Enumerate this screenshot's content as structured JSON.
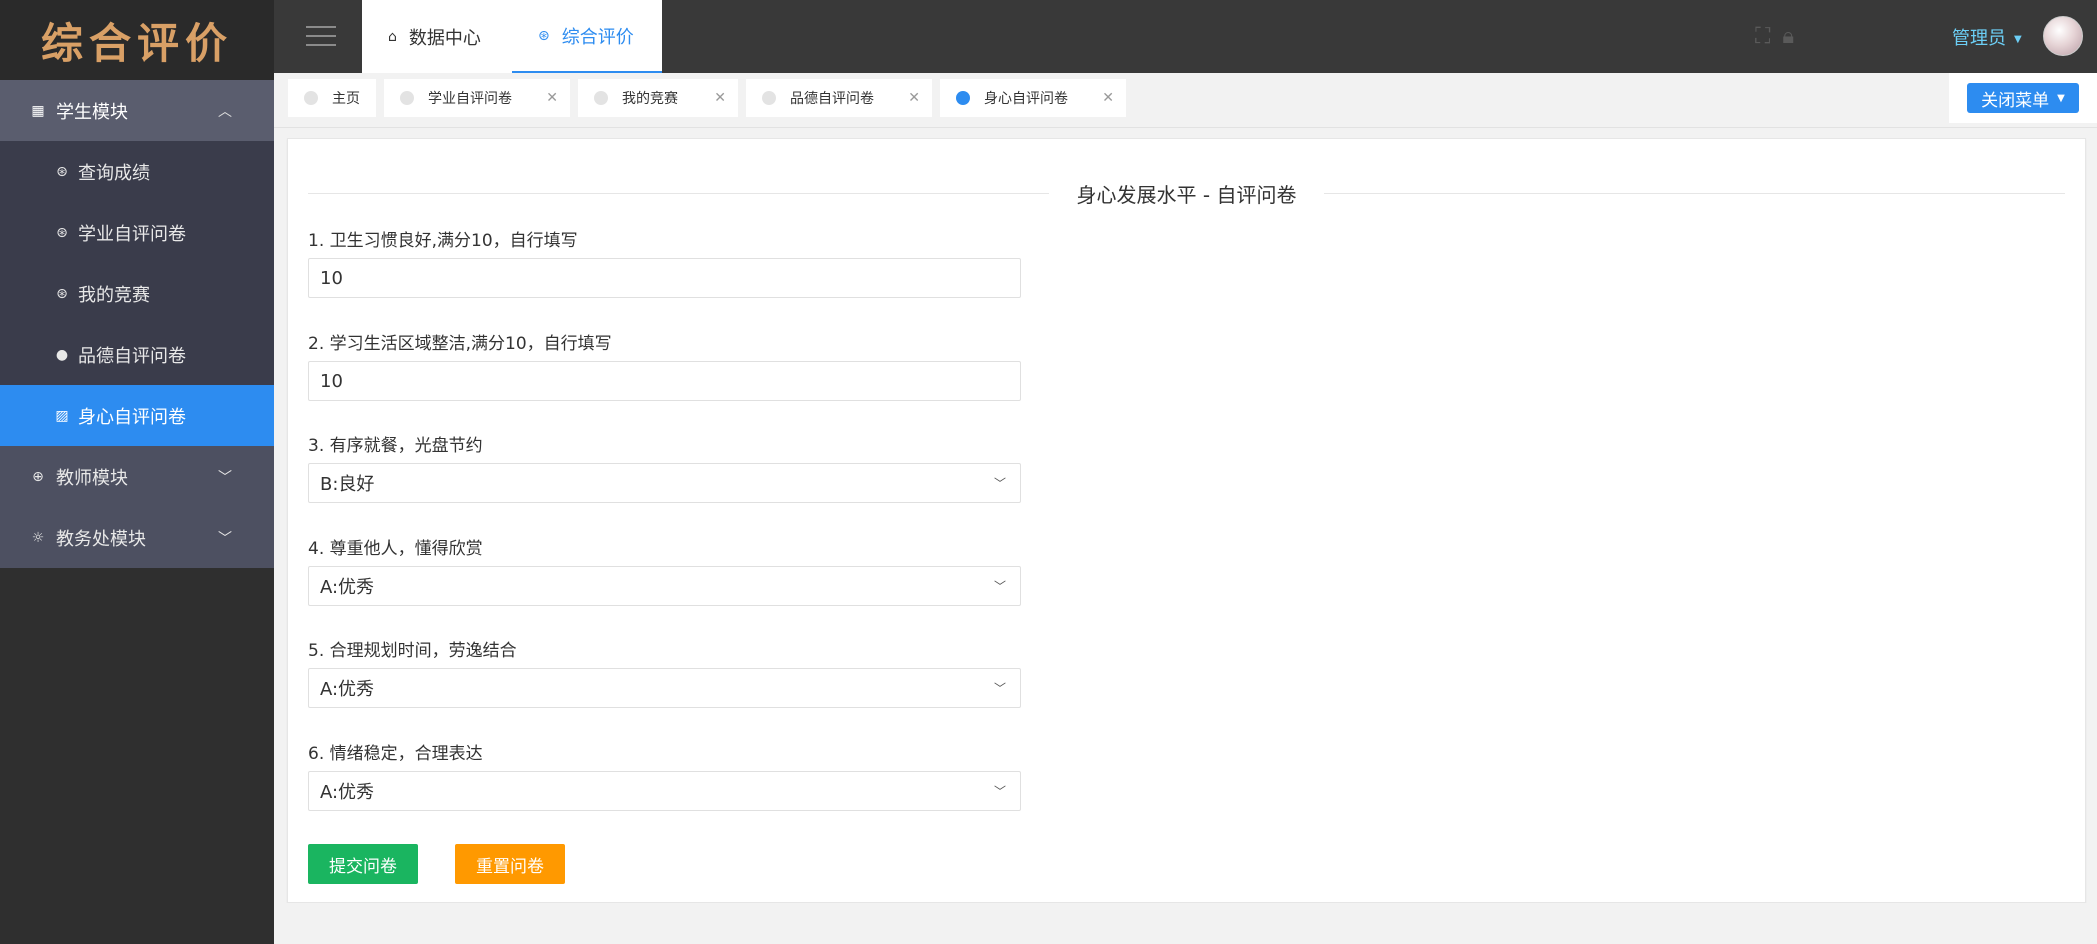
{
  "app": {
    "logo": "综合评价"
  },
  "sidebar": {
    "student_module": {
      "label": "学生模块",
      "icon": "grid-icon",
      "expanded": true
    },
    "items": [
      {
        "label": "查询成绩",
        "icon": "circle-icon"
      },
      {
        "label": "学业自评问卷",
        "icon": "circle-icon"
      },
      {
        "label": "我的竞赛",
        "icon": "circle-icon"
      },
      {
        "label": "品德自评问卷",
        "icon": "circle-icon"
      },
      {
        "label": "身心自评问卷",
        "icon": "chart-icon",
        "active": true
      }
    ],
    "teacher_module": {
      "label": "教师模块",
      "icon": "basketball-icon"
    },
    "office_module": {
      "label": "教务处模块",
      "icon": "bulb-icon"
    }
  },
  "topbar": {
    "tabs": [
      {
        "label": "数据中心",
        "icon": "home-icon"
      },
      {
        "label": "综合评价",
        "icon": "globe-icon",
        "active": true
      }
    ],
    "admin_label": "管理员"
  },
  "page_tabs": [
    {
      "label": "主页",
      "closable": false
    },
    {
      "label": "学业自评问卷",
      "closable": true
    },
    {
      "label": "我的竞赛",
      "closable": true
    },
    {
      "label": "品德自评问卷",
      "closable": true
    },
    {
      "label": "身心自评问卷",
      "closable": true,
      "active": true
    }
  ],
  "close_menu_label": "关闭菜单",
  "form": {
    "title": "身心发展水平 - 自评问卷",
    "questions": [
      {
        "label": "1. 卫生习惯良好,满分10，自行填写",
        "type": "input",
        "value": "10"
      },
      {
        "label": "2. 学习生活区域整洁,满分10，自行填写",
        "type": "input",
        "value": "10"
      },
      {
        "label": "3. 有序就餐，光盘节约",
        "type": "select",
        "value": "B:良好"
      },
      {
        "label": "4. 尊重他人，懂得欣赏",
        "type": "select",
        "value": "A:优秀"
      },
      {
        "label": "5. 合理规划时间，劳逸结合",
        "type": "select",
        "value": "A:优秀"
      },
      {
        "label": "6. 情绪稳定，合理表达",
        "type": "select",
        "value": "A:优秀"
      }
    ],
    "submit_label": "提交问卷",
    "reset_label": "重置问卷"
  },
  "colors": {
    "accent": "#2d8cf0",
    "submit": "#1ab560",
    "reset": "#ff9900",
    "logo": "#d9a066"
  }
}
